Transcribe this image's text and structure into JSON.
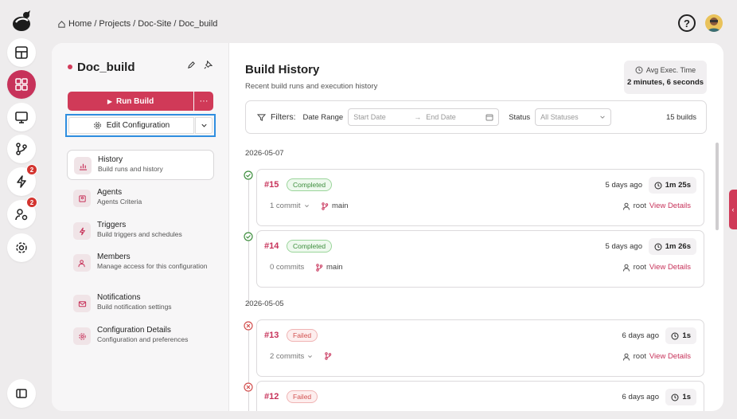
{
  "breadcrumb": {
    "home": "Home",
    "sep": "/",
    "projects": "Projects",
    "site": "Doc-Site",
    "current": "Doc_build"
  },
  "rail": {
    "badges": {
      "builds": "2",
      "users": "2"
    }
  },
  "project": {
    "title": "Doc_build"
  },
  "actions": {
    "run_label": "Run Build",
    "more": "···",
    "edit_label": "Edit Configuration"
  },
  "nav": [
    {
      "title": "History",
      "subtitle": "Build runs and history"
    },
    {
      "title": "Agents",
      "subtitle": "Agents Criteria"
    },
    {
      "title": "Triggers",
      "subtitle": "Build triggers and schedules"
    },
    {
      "title": "Members",
      "subtitle": "Manage access for this configuration"
    },
    {
      "title": "Notifications",
      "subtitle": "Build notification settings"
    },
    {
      "title": "Configuration Details",
      "subtitle": "Configuration and preferences"
    }
  ],
  "history": {
    "title": "Build History",
    "subtitle": "Recent build runs and execution history",
    "avg_label": "Avg Exec. Time",
    "avg_value": "2 minutes, 6 seconds"
  },
  "filters": {
    "label": "Filters:",
    "date_label": "Date Range",
    "start": "Start Date",
    "arrow": "→",
    "end": "End Date",
    "status_label": "Status",
    "status_value": "All Statuses",
    "count": "15 builds"
  },
  "groups": [
    {
      "date": "2026-05-07"
    },
    {
      "date": "2026-05-05"
    }
  ],
  "builds": [
    {
      "num": "#15",
      "status": "Completed",
      "ago": "5 days ago",
      "dur": "1m 25s",
      "commits": "1 commit",
      "branch": "main",
      "user": "root",
      "view": "View Details"
    },
    {
      "num": "#14",
      "status": "Completed",
      "ago": "5 days ago",
      "dur": "1m 26s",
      "commits": "0 commits",
      "branch": "main",
      "user": "root",
      "view": "View Details"
    },
    {
      "num": "#13",
      "status": "Failed",
      "ago": "6 days ago",
      "dur": "1s",
      "commits": "2 commits",
      "branch": "",
      "user": "root",
      "view": "View Details"
    },
    {
      "num": "#12",
      "status": "Failed",
      "ago": "6 days ago",
      "dur": "1s"
    }
  ],
  "colors": {
    "accent": "#c7325a",
    "success": "#3e8e3e",
    "error": "#d2504f",
    "highlight": "#2f8ee0"
  }
}
